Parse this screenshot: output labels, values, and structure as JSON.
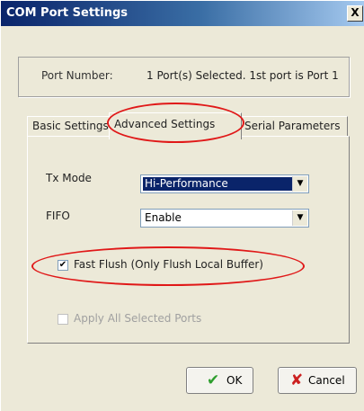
{
  "window": {
    "title": "COM Port Settings",
    "close_glyph": "X"
  },
  "port": {
    "label": "Port Number:",
    "value": "1 Port(s) Selected. 1st port is Port 1"
  },
  "tabs": [
    {
      "label": "Basic Settings",
      "active": false
    },
    {
      "label": "Advanced Settings",
      "active": true
    },
    {
      "label": "Serial Parameters",
      "active": false
    }
  ],
  "advanced": {
    "tx_mode": {
      "label": "Tx Mode",
      "value": "Hi-Performance"
    },
    "fifo": {
      "label": "FIFO",
      "value": "Enable"
    },
    "fast_flush": {
      "label": "Fast Flush (Only Flush Local Buffer)",
      "checked": true
    },
    "apply_all": {
      "label": "Apply All Selected Ports",
      "checked": false,
      "enabled": false
    }
  },
  "buttons": {
    "ok_label": "OK",
    "cancel_label": "Cancel"
  },
  "icons": {
    "dropdown": "chevron-down-icon",
    "check": "checkmark-icon",
    "ok": "green-check-icon",
    "cancel": "red-x-icon"
  },
  "colors": {
    "highlight": "#e01818",
    "selection": "#0a246a",
    "ok_icon": "#2e9e2e",
    "cancel_icon": "#cc2020"
  }
}
